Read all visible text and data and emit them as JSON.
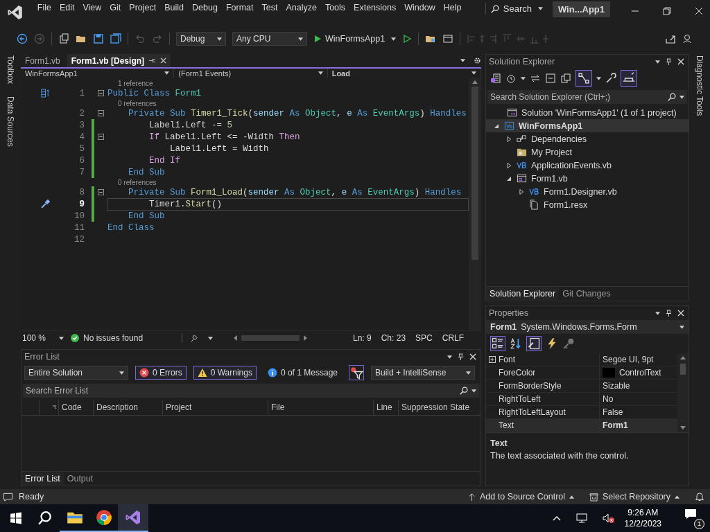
{
  "menu": [
    "File",
    "Edit",
    "View",
    "Git",
    "Project",
    "Build",
    "Debug",
    "Format",
    "Test",
    "Analyze",
    "Tools",
    "Extensions",
    "Window",
    "Help"
  ],
  "search": {
    "label": "Search"
  },
  "window": {
    "title": "Win...App1"
  },
  "toolbar": {
    "configuration": "Debug",
    "platform": "Any CPU",
    "start": "WinFormsApp1"
  },
  "left_tabs": [
    "Toolbox",
    "Data Sources"
  ],
  "right_tabs": [
    "Diagnostic Tools"
  ],
  "document_tabs": [
    {
      "label": "Form1.vb",
      "selected": false
    },
    {
      "label": "Form1.vb [Design]",
      "selected": true
    }
  ],
  "navigation": [
    "WinFormsApp1",
    "(Form1 Events)",
    "Load"
  ],
  "code_lines": [
    {
      "number": "1",
      "kind": "class",
      "lens": "1 reference",
      "fold": true,
      "changed": false,
      "current": false,
      "tokens": [
        {
          "kind": "keyword",
          "text": "Public Class "
        },
        {
          "kind": "type",
          "text": "Form1"
        }
      ]
    },
    {
      "number": "2",
      "kind": "method",
      "lens": "0 references",
      "fold": true,
      "changed": false,
      "current": false,
      "tokens": [
        {
          "kind": "keyword",
          "text": "    Private Sub "
        },
        {
          "kind": "method",
          "text": "Timer1_Tick"
        },
        {
          "kind": "plain",
          "text": "("
        },
        {
          "kind": "param",
          "text": "sender"
        },
        {
          "kind": "keyword",
          "text": " As "
        },
        {
          "kind": "type",
          "text": "Object"
        },
        {
          "kind": "plain",
          "text": ", "
        },
        {
          "kind": "param",
          "text": "e"
        },
        {
          "kind": "keyword",
          "text": " As "
        },
        {
          "kind": "type",
          "text": "EventArgs"
        },
        {
          "kind": "plain",
          "text": ") "
        },
        {
          "kind": "keyword",
          "text": "Handles"
        }
      ]
    },
    {
      "number": "3",
      "kind": "statement",
      "fold": false,
      "changed": true,
      "current": false,
      "tokens": [
        {
          "kind": "plain",
          "text": "        Label1.Left -= "
        },
        {
          "kind": "number",
          "text": "5"
        }
      ]
    },
    {
      "number": "4",
      "kind": "statement",
      "fold": true,
      "changed": true,
      "current": false,
      "tokens": [
        {
          "kind": "control",
          "text": "        If"
        },
        {
          "kind": "plain",
          "text": " Label1.Left <= -Width "
        },
        {
          "kind": "control",
          "text": "Then"
        }
      ]
    },
    {
      "number": "5",
      "kind": "statement",
      "fold": false,
      "changed": true,
      "current": false,
      "tokens": [
        {
          "kind": "plain",
          "text": "            Label1.Left = Width"
        }
      ]
    },
    {
      "number": "6",
      "kind": "statement",
      "fold": false,
      "changed": true,
      "current": false,
      "tokens": [
        {
          "kind": "control",
          "text": "        End If"
        }
      ]
    },
    {
      "number": "7",
      "kind": "statement",
      "fold": false,
      "changed": true,
      "current": false,
      "tokens": [
        {
          "kind": "keyword",
          "text": "    End Sub"
        }
      ]
    },
    {
      "number": "8",
      "kind": "method",
      "lens": "0 references",
      "fold": true,
      "changed": true,
      "current": false,
      "tokens": [
        {
          "kind": "keyword",
          "text": "    Private Sub "
        },
        {
          "kind": "method",
          "text": "Form1_Load"
        },
        {
          "kind": "plain",
          "text": "("
        },
        {
          "kind": "param",
          "text": "sender"
        },
        {
          "kind": "keyword",
          "text": " As "
        },
        {
          "kind": "type",
          "text": "Object"
        },
        {
          "kind": "plain",
          "text": ", "
        },
        {
          "kind": "param",
          "text": "e"
        },
        {
          "kind": "keyword",
          "text": " As "
        },
        {
          "kind": "type",
          "text": "EventArgs"
        },
        {
          "kind": "plain",
          "text": ") "
        },
        {
          "kind": "keyword",
          "text": "Handles"
        }
      ]
    },
    {
      "number": "9",
      "kind": "statement",
      "fold": false,
      "changed": true,
      "current": true,
      "tokens": [
        {
          "kind": "plain",
          "text": "        Timer1."
        },
        {
          "kind": "method",
          "text": "Start"
        },
        {
          "kind": "plain",
          "text": "()"
        }
      ]
    },
    {
      "number": "10",
      "kind": "statement",
      "fold": false,
      "changed": true,
      "current": false,
      "tokens": [
        {
          "kind": "keyword",
          "text": "    End Sub"
        }
      ]
    },
    {
      "number": "11",
      "kind": "statement",
      "fold": false,
      "changed": false,
      "current": false,
      "tokens": [
        {
          "kind": "keyword",
          "text": "End Class"
        }
      ]
    },
    {
      "number": "12",
      "kind": "empty",
      "fold": false,
      "changed": false,
      "current": false
    }
  ],
  "editor_status": {
    "zoom": "100 %",
    "issues": "No issues found",
    "line": "Ln: 9",
    "column": "Ch: 23",
    "whitespace": "SPC",
    "line_endings": "CRLF"
  },
  "error_list": {
    "title": "Error List",
    "scope": "Entire Solution",
    "filters": [
      {
        "kind": "error",
        "label": "0 Errors",
        "on": true
      },
      {
        "kind": "warning",
        "label": "0 Warnings",
        "on": true
      },
      {
        "kind": "info",
        "label": "0 of 1 Message",
        "on": false
      }
    ],
    "source": "Build + IntelliSense",
    "search_placeholder": "Search Error List",
    "columns": [
      "Code",
      "Description",
      "Project",
      "File",
      "Line",
      "Suppression State"
    ]
  },
  "bottom_tabs": [
    {
      "label": "Error List",
      "selected": true
    },
    {
      "label": "Output",
      "selected": false
    }
  ],
  "solution_explorer": {
    "title": "Solution Explorer",
    "search_placeholder": "Search Solution Explorer (Ctrl+;)",
    "tree": [
      {
        "label": "Solution 'WinFormsApp1' (1 of 1 project)",
        "kind": "solution",
        "expandable": false,
        "expanded": true,
        "bold": false,
        "children": [
          {
            "label": "WinFormsApp1",
            "kind": "project",
            "expandable": true,
            "expanded": true,
            "bold": true,
            "children": [
              {
                "label": "Dependencies",
                "kind": "dependencies",
                "expandable": true,
                "expanded": false,
                "bold": false
              },
              {
                "label": "My Project",
                "kind": "properties",
                "expandable": false,
                "bold": false
              },
              {
                "label": "ApplicationEvents.vb",
                "kind": "code",
                "expandable": true,
                "expanded": false,
                "bold": false
              },
              {
                "label": "Form1.vb",
                "kind": "form",
                "expandable": true,
                "expanded": true,
                "bold": false,
                "children": [
                  {
                    "label": "Form1.Designer.vb",
                    "kind": "code",
                    "expandable": true,
                    "expanded": false,
                    "bold": false
                  },
                  {
                    "label": "Form1.resx",
                    "kind": "resource",
                    "expandable": false,
                    "bold": false
                  }
                ]
              }
            ]
          }
        ]
      }
    ]
  },
  "side_tabs": [
    {
      "label": "Solution Explorer",
      "selected": true
    },
    {
      "label": "Git Changes",
      "selected": false
    }
  ],
  "properties": {
    "title": "Properties",
    "object_name": "Form1",
    "object_type": "System.Windows.Forms.Form",
    "rows": [
      {
        "name": "Font",
        "value": "Segoe UI, 9pt",
        "expandable": true,
        "bold": false,
        "selected": false
      },
      {
        "name": "ForeColor",
        "value": "ControlText",
        "expandable": false,
        "bold": false,
        "selected": false,
        "color": "#000000"
      },
      {
        "name": "FormBorderStyle",
        "value": "Sizable",
        "expandable": false,
        "bold": false,
        "selected": false
      },
      {
        "name": "RightToLeft",
        "value": "No",
        "expandable": false,
        "bold": false,
        "selected": false
      },
      {
        "name": "RightToLeftLayout",
        "value": "False",
        "expandable": false,
        "bold": false,
        "selected": false
      },
      {
        "name": "Text",
        "value": "Form1",
        "expandable": false,
        "bold": true,
        "selected": true
      }
    ],
    "description_title": "Text",
    "description": "The text associated with the control."
  },
  "status_bar": {
    "message": "Ready",
    "source_control": "Add to Source Control",
    "repository": "Select Repository"
  },
  "taskbar": {
    "time": "9:26 AM",
    "date": "12/2/2023",
    "notifications": "1"
  }
}
